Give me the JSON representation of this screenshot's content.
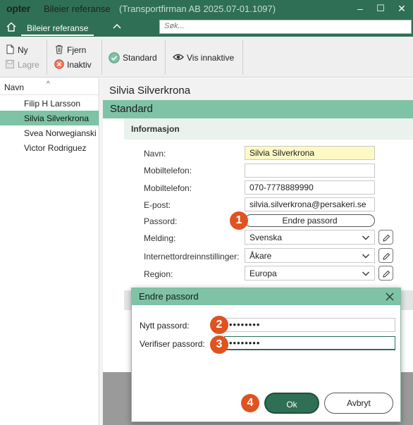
{
  "window": {
    "logo": "opter",
    "title": "Bileier referanse",
    "subtitle": "(Transportfirman AB 2025.07-01.1097)",
    "controls": [
      "–",
      "☐",
      "✕"
    ]
  },
  "tabs": {
    "active": "Bileier referanse"
  },
  "search": {
    "placeholder": "Søk..."
  },
  "toolbar": {
    "new_label": "Ny",
    "save_label": "Lagre",
    "remove_label": "Fjern",
    "inactive_label": "Inaktiv",
    "standard_label": "Standard",
    "show_inactive_label": "Vis innaktive"
  },
  "list": {
    "header": "Navn",
    "items": [
      "Filip H Larsson",
      "Silvia Silverkrona",
      "Svea Norwegianski",
      "Victor Rodriguez"
    ],
    "selected": "Silvia Silverkrona"
  },
  "detail": {
    "person_title": "Silvia Silverkrona",
    "section": "Standard",
    "group": "Informasjon",
    "fields": {
      "name_label": "Navn:",
      "name_value": "Silvia Silverkrona",
      "mobile1_label": "Mobiltelefon:",
      "mobile1_value": "",
      "mobile2_label": "Mobiltelefon:",
      "mobile2_value": "070-7778889990",
      "email_label": "E-post:",
      "email_value": "silvia.silverkrona@persakeri.se",
      "password_label": "Passord:",
      "password_button": "Endre passord",
      "message_label": "Melding:",
      "message_value": "Svenska",
      "web_label": "Internettordreinnstillinger:",
      "web_value": "Åkare",
      "region_label": "Region:",
      "region_value": "Europa"
    }
  },
  "dialog": {
    "title": "Endre passord",
    "new_label": "Nytt passord:",
    "new_value": "••••••••",
    "verify_label": "Verifiser passord:",
    "verify_value": "••••••••",
    "ok_label": "Ok",
    "cancel_label": "Avbryt"
  },
  "badges": [
    "1",
    "2",
    "3",
    "4"
  ],
  "colors": {
    "brand": "#2f6f55",
    "accent": "#7ec3a6",
    "badge": "#e0521f",
    "highlight": "#fdf9c4"
  }
}
